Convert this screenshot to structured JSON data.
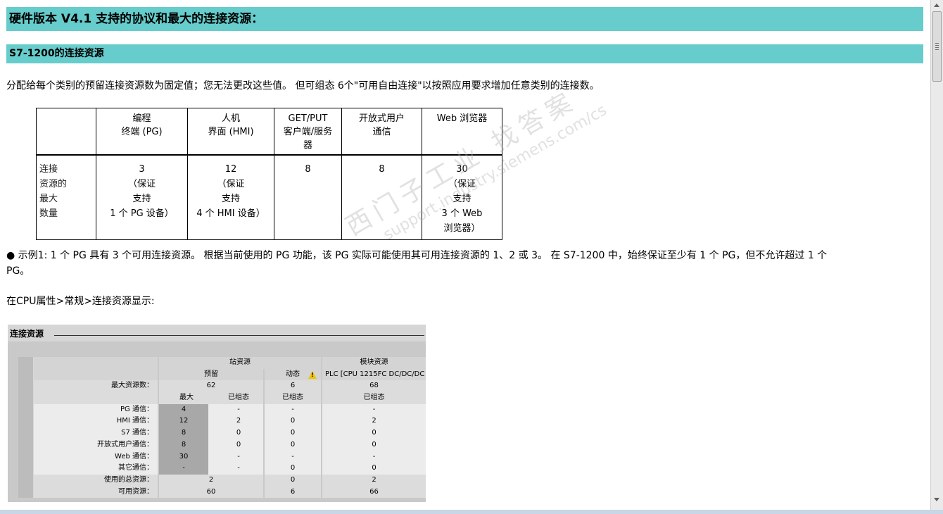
{
  "heading1": "硬件版本 V4.1 支持的协议和最大的连接资源：",
  "heading2": "S7-1200的连接资源",
  "intro": "分配给每个类别的预留连接资源数为固定值；您无法更改这些值。 但可组态 6个\"可用自由连接\"以按照应用要求增加任意类别的连接数。",
  "table": {
    "headers": [
      [],
      [
        "编程",
        "终端 (PG)"
      ],
      [
        "人机",
        "界面 (HMI)"
      ],
      [
        "GET/PUT",
        "客户端/服务",
        "器"
      ],
      [
        "开放式用户",
        "通信"
      ],
      [
        "Web 浏览器"
      ]
    ],
    "row": [
      [
        "连接",
        "资源的",
        "最大",
        "数量"
      ],
      [
        "3",
        "（保证",
        "支持",
        "1 个 PG 设备）"
      ],
      [
        "12",
        "（保证",
        "支持",
        "4 个 HMI 设备）"
      ],
      [
        "8"
      ],
      [
        "8"
      ],
      [
        "30",
        "（保证",
        "支持",
        "3 个 Web",
        "浏览器）"
      ]
    ]
  },
  "example": "● 示例1: 1 个 PG 具有 3 个可用连接资源。 根据当前使用的 PG 功能，该 PG 实际可能使用其可用连接资源的 1、2 或 3。 在 S7-1200 中，始终保证至少有 1 个 PG，但不允许超过 1 个",
  "example_cont": "PG。",
  "cpu_note": "在CPU属性>常规>连接资源显示:",
  "panel": {
    "title": "连接资源",
    "group_station": "站资源",
    "group_module": "模块资源",
    "col_reserved": "预留",
    "col_dynamic": "动态",
    "col_plc": "PLC [CPU 1215FC DC/DC/DC",
    "max_label": "最大资源数：",
    "max_values": [
      "62",
      "6",
      "68"
    ],
    "sub_headers": [
      "最大",
      "已组态",
      "已组态",
      "已组态"
    ],
    "rows": [
      {
        "label": "PG 通信：",
        "v": [
          "4",
          "-",
          "-",
          "-"
        ]
      },
      {
        "label": "HMI 通信：",
        "v": [
          "12",
          "2",
          "0",
          "2"
        ]
      },
      {
        "label": "S7 通信：",
        "v": [
          "8",
          "0",
          "0",
          "0"
        ]
      },
      {
        "label": "开放式用户通信：",
        "v": [
          "8",
          "0",
          "0",
          "0"
        ]
      },
      {
        "label": "Web 通信：",
        "v": [
          "30",
          "-",
          "-",
          "-"
        ]
      },
      {
        "label": "其它通信：",
        "v": [
          "-",
          "-",
          "0",
          "0"
        ]
      }
    ],
    "total_label": "使用的总资源：",
    "total_values": [
      "2",
      "0",
      "2"
    ],
    "avail_label": "可用资源：",
    "avail_values": [
      "60",
      "6",
      "66"
    ]
  },
  "watermark": {
    "line1": "西门子工业 找答案",
    "line2": "support.industry.siemens.com/cs"
  }
}
